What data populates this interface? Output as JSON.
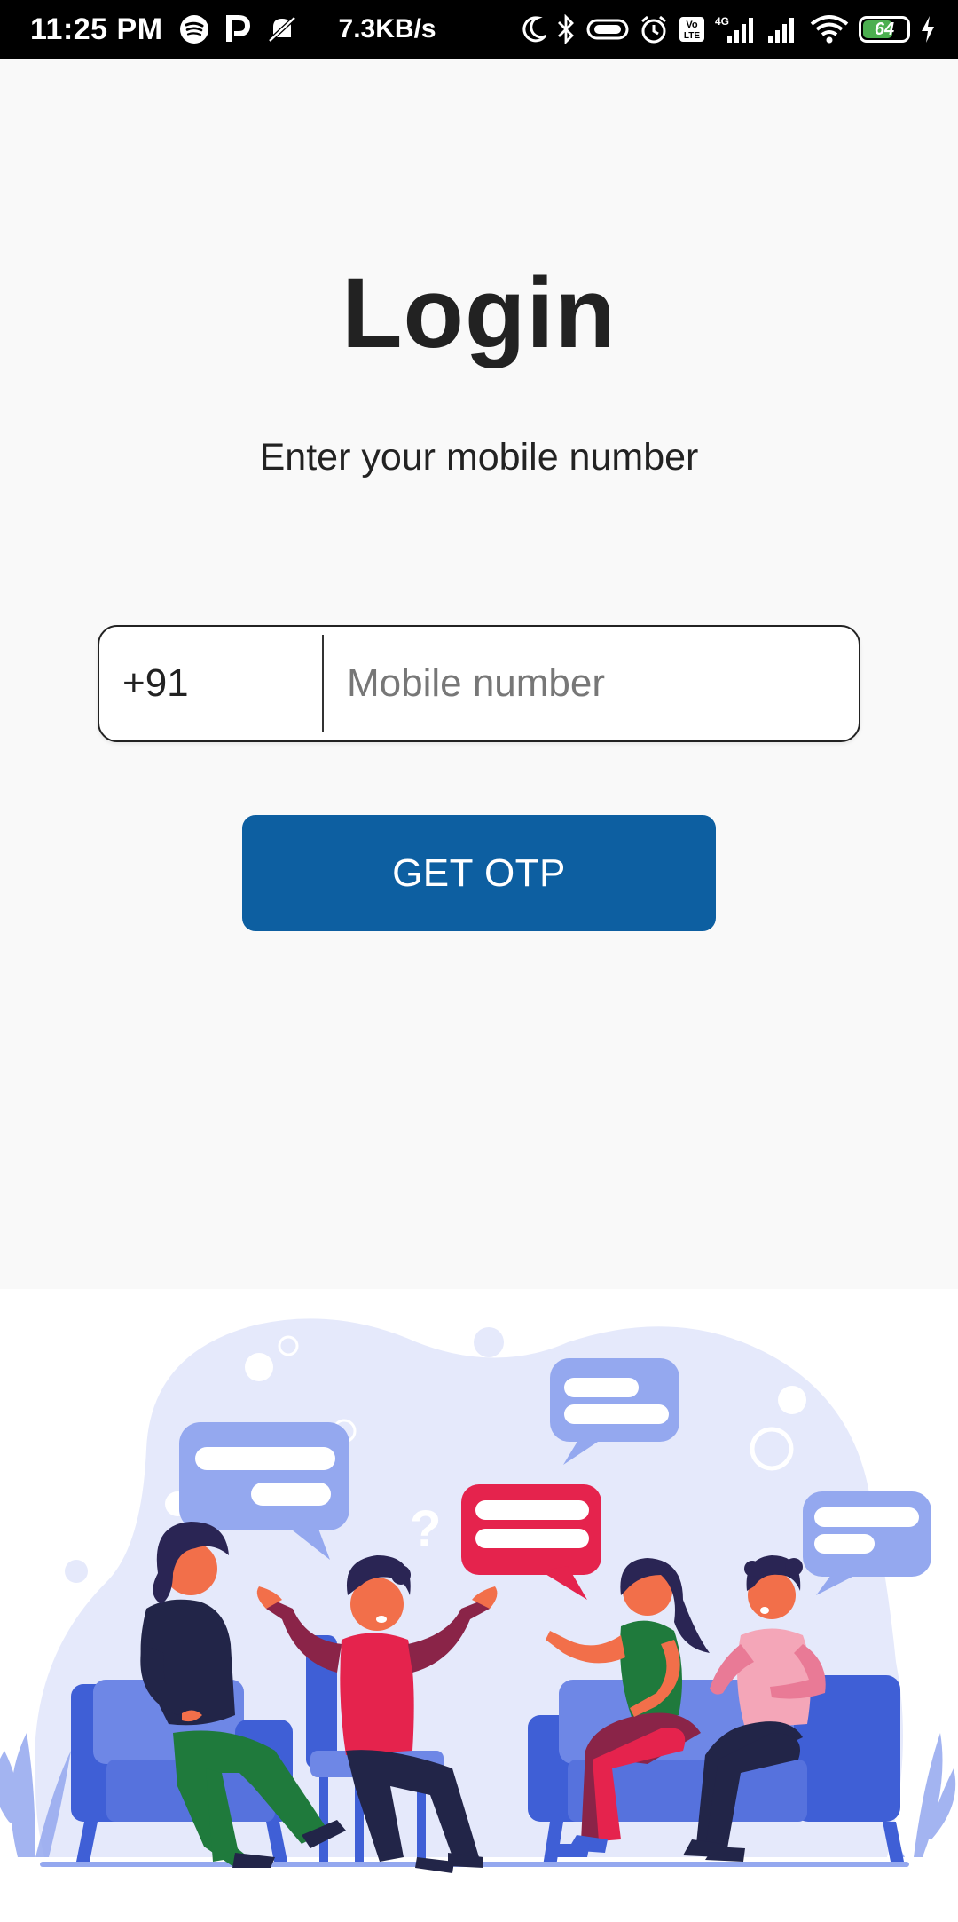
{
  "status_bar": {
    "time": "11:25 PM",
    "net_speed": "7.3KB/s",
    "battery_level": "64",
    "network_type": "4G",
    "icons": [
      "spotify-icon",
      "p-app-icon",
      "mute-icon",
      "moon-icon",
      "bluetooth-icon",
      "vibrate-icon",
      "alarm-icon",
      "volte-icon",
      "signal-icon",
      "signal-icon",
      "wifi-icon",
      "battery-icon",
      "charging-icon"
    ]
  },
  "login": {
    "title": "Login",
    "subtitle": "Enter your mobile number",
    "country_code": "+91",
    "mobile_placeholder": "Mobile number",
    "mobile_value": "",
    "button_label": "GET OTP"
  },
  "colors": {
    "primary_button": "#0d5fa1",
    "background": "#f9f9f9",
    "illustration_blob": "#e5e9fb",
    "bubble_blue": "#94a8ef",
    "bubble_red": "#e5234d"
  }
}
